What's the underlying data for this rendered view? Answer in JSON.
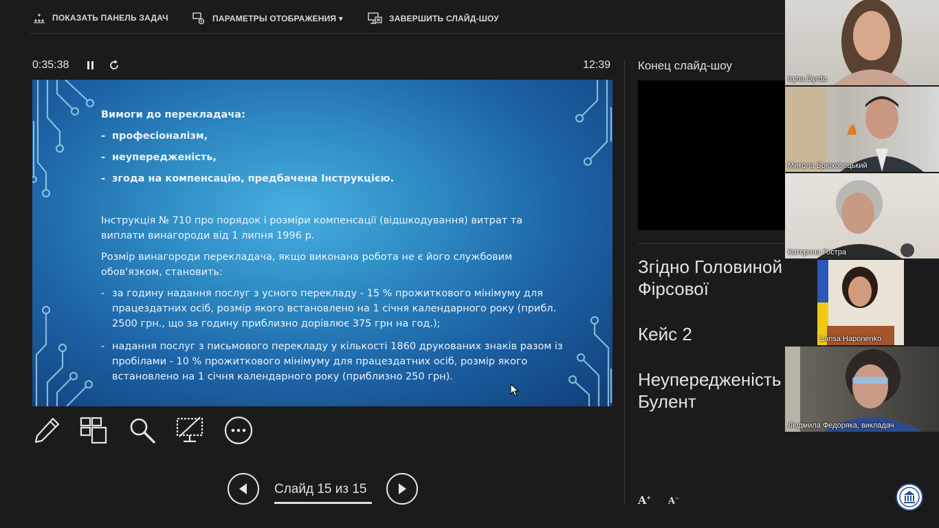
{
  "toolbar": {
    "taskbar_label": "ПОКАЗАТЬ ПАНЕЛЬ ЗАДАЧ",
    "display_label": "ПАРАМЕТРЫ ОТОБРАЖЕНИЯ ▾",
    "end_label": "ЗАВЕРШИТЬ СЛАЙД-ШОУ"
  },
  "timer": {
    "elapsed": "0:35:38",
    "clock": "12:39"
  },
  "slide": {
    "requirements_title": "Вимоги до перекладача:",
    "requirements": [
      "професіоналізм,",
      "неупередженість,",
      "згода на компенсацію, предбачена Інструкцією."
    ],
    "instruction": "Інструкція № 710 про порядок і розміри компенсації (відшкодування) витрат та виплати винагороди від 1 липня 1996 р.",
    "fee_intro": "Розмір винагороди перекладача, якщо виконана робота не є його службовим обов'язком, становить:",
    "fees": [
      "за годину надання послуг з усного перекладу - 15 % прожиткового мінімуму для працездатних осіб, розмір якого встановлено на 1 січня календарного року (прибл. 2500 грн., що за годину приблизно дорівлює 375 грн на год.);",
      "надання послуг з письмового перекладу у кількості 1860 друкованих знаків разом із пробілами - 10 % прожиткового мінімуму для працездатних осіб, розмір якого встановлено на 1 січня календарного року (приблизно 250 грн)."
    ],
    "dash": "-"
  },
  "navigation": {
    "slide_counter": "Слайд 15 из 15"
  },
  "next_slide": {
    "label": "Конец слайд-шоу"
  },
  "notes": [
    "Згідно Головиной Фірсової",
    "Кейс 2",
    "Неупередженість Булент"
  ],
  "font_controls": {
    "increase": "A",
    "decrease": "A"
  },
  "participants": [
    {
      "name": "Iryna Dyrda"
    },
    {
      "name": "Микола Брюховецький"
    },
    {
      "name": "Катерина Гостра"
    },
    {
      "name": "Larisa Haponenko"
    },
    {
      "name": "Людмила Федоряка, викладач"
    }
  ],
  "icons": {
    "taskbar": "taskbar-icon",
    "display": "display-settings-icon",
    "end": "end-show-icon",
    "pause": "pause-icon",
    "restart": "restart-icon",
    "pen": "pen-icon",
    "grid": "slides-grid-icon",
    "zoom": "zoom-icon",
    "blackout": "screen-off-icon",
    "more": "more-options-icon",
    "prev": "previous-arrow-icon",
    "next": "next-arrow-icon"
  },
  "colors": {
    "background": "#1b1b1b",
    "slide_blue": "#2f8cc4",
    "text": "#e6e6e6"
  }
}
